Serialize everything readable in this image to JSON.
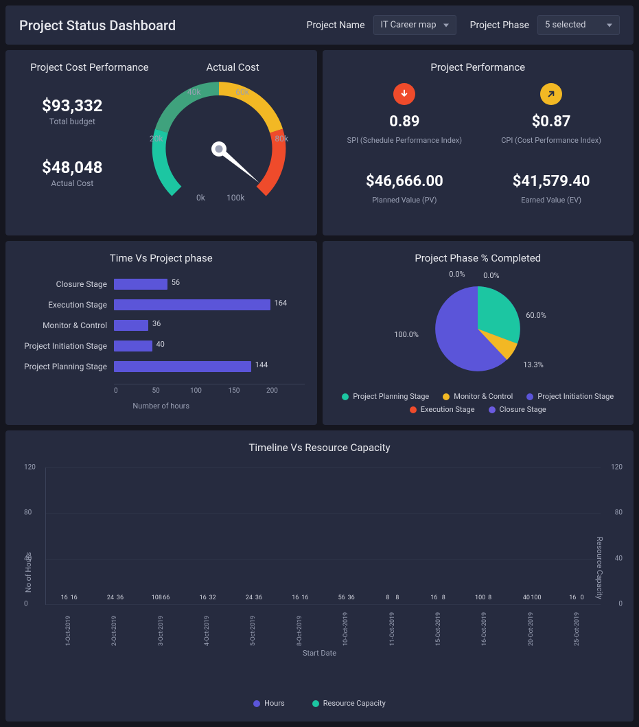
{
  "page_title": "Project Status Dashboard",
  "filters": {
    "project_name_label": "Project Name",
    "project_name_value": "IT Career map",
    "project_phase_label": "Project Phase",
    "project_phase_value": "5 selected"
  },
  "cost": {
    "title_left": "Project Cost Performance",
    "title_right": "Actual Cost",
    "budget_value": "$93,332",
    "budget_label": "Total budget",
    "actual_value": "$48,048",
    "actual_label": "Actual Cost",
    "gauge_ticks": [
      "0k",
      "20k",
      "40k",
      "60k",
      "80k",
      "100k"
    ]
  },
  "perf": {
    "title": "Project Performance",
    "spi_value": "0.89",
    "spi_label": "SPI (Schedule Performance Index)",
    "cpi_value": "$0.87",
    "cpi_label": "CPI (Cost Performance Index)",
    "pv_value": "$46,666.00",
    "pv_label": "Planned Value (PV)",
    "ev_value": "$41,579.40",
    "ev_label": "Earned Value (EV)"
  },
  "time_phase": {
    "title": "Time Vs Project phase",
    "xlabel": "Number of hours",
    "xticks": [
      "0",
      "50",
      "100",
      "150",
      "200"
    ]
  },
  "pie": {
    "title": "Project Phase % Completed",
    "labels": [
      "60.0%",
      "13.3%",
      "100.0%",
      "0.0%",
      "0.0%"
    ],
    "legend": [
      "Project Planning Stage",
      "Monitor & Control",
      "Project Initiation Stage",
      "Execution Stage",
      "Closure Stage"
    ]
  },
  "timeline": {
    "title": "Timeline Vs Resource Capacity",
    "y_label_left": "No of Hours",
    "y_label_right": "Resource Capacity",
    "x_label": "Start Date",
    "y_ticks": [
      "0",
      "40",
      "80",
      "120"
    ],
    "legend": [
      "Hours",
      "Resource Capacity"
    ]
  },
  "chart_data": [
    {
      "type": "gauge",
      "title": "Actual Cost",
      "min": 0,
      "max": 100000,
      "value": 48048,
      "ticks": [
        0,
        20000,
        40000,
        60000,
        80000,
        100000
      ]
    },
    {
      "type": "bar",
      "orientation": "horizontal",
      "title": "Time Vs Project phase",
      "xlabel": "Number of hours",
      "categories": [
        "Closure Stage",
        "Execution Stage",
        "Monitor & Control",
        "Project Initiation Stage",
        "Project Planning Stage"
      ],
      "values": [
        56,
        164,
        36,
        40,
        144
      ],
      "xlim": [
        0,
        200
      ]
    },
    {
      "type": "pie",
      "title": "Project Phase % Completed",
      "series": [
        {
          "name": "Project Planning Stage",
          "value": 60.0,
          "color": "#1cc6a2"
        },
        {
          "name": "Monitor & Control",
          "value": 13.3,
          "color": "#f2b824"
        },
        {
          "name": "Project Initiation Stage",
          "value": 100.0,
          "color": "#5b55d9"
        },
        {
          "name": "Execution Stage",
          "value": 0.0,
          "color": "#ef4b2b"
        },
        {
          "name": "Closure Stage",
          "value": 0.0,
          "color": "#6b5be0"
        }
      ]
    },
    {
      "type": "bar",
      "title": "Timeline Vs Resource Capacity",
      "xlabel": "Start Date",
      "ylabel": "No of Hours",
      "ylabel_right": "Resource Capacity",
      "ylim": [
        0,
        120
      ],
      "categories": [
        "1-Oct-2019",
        "2-Oct-2019",
        "3-Oct-2019",
        "4-Oct-2019",
        "5-Oct-2019",
        "8-Oct-2019",
        "10-Oct-2019",
        "11-Oct-2019",
        "15-Oct-2019",
        "16-Oct-2019",
        "20-Oct-2019",
        "25-Oct-2019"
      ],
      "series": [
        {
          "name": "Hours",
          "color": "#5b55d9",
          "values": [
            16,
            24,
            108,
            16,
            24,
            16,
            56,
            8,
            16,
            100,
            40,
            16
          ]
        },
        {
          "name": "Resource Capacity",
          "color": "#1cc6a2",
          "values": [
            16,
            36,
            66,
            32,
            36,
            16,
            36,
            8,
            8,
            8,
            100,
            0
          ]
        }
      ]
    }
  ]
}
